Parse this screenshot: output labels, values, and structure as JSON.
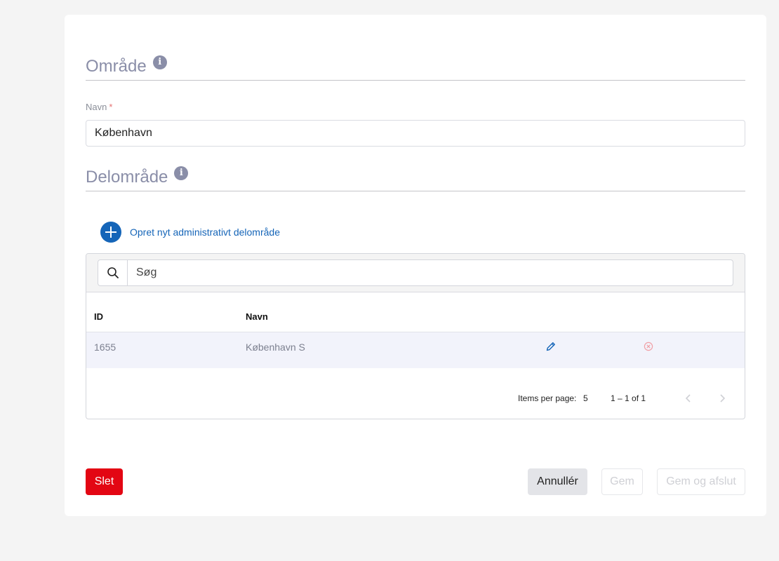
{
  "area": {
    "title": "Område",
    "name_label": "Navn",
    "required_marker": "*",
    "name_value": "København"
  },
  "subarea": {
    "title": "Delområde",
    "create_label": "Opret nyt administrativt delområde",
    "search_placeholder": "Søg",
    "columns": {
      "id": "ID",
      "name": "Navn"
    },
    "rows": [
      {
        "id": "1655",
        "name": "København S"
      }
    ],
    "paginator": {
      "items_per_page_label": "Items per page:",
      "page_size": "5",
      "range": "1 – 1 of 1"
    }
  },
  "icons": {
    "info": "info-icon",
    "add": "plus-circle-icon",
    "search": "search-icon",
    "edit": "pencil-icon",
    "delete": "circle-x-icon",
    "prev": "chevron-left-icon",
    "next": "chevron-right-icon"
  },
  "actions": {
    "delete": "Slet",
    "cancel": "Annullér",
    "save": "Gem",
    "save_close": "Gem og afslut"
  },
  "colors": {
    "primary": "#1565b8",
    "danger": "#e30613",
    "heading": "#8a8ea8",
    "delete_icon": "#f0a0a6"
  }
}
